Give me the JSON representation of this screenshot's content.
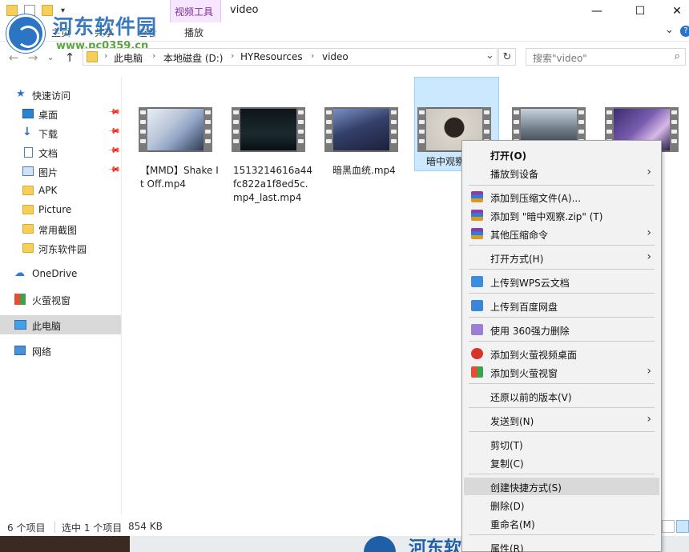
{
  "window": {
    "title": "video",
    "contextual_tab_group": "视频工具",
    "min_glyph": "—",
    "max_glyph": "☐",
    "close_glyph": "✕"
  },
  "ribbon": {
    "tabs": [
      "主页",
      "共享",
      "查看",
      "播放"
    ],
    "expand_glyph": "⌄",
    "help_glyph": "?"
  },
  "watermark": {
    "text": "河东软件园",
    "url": "www.pc0359.cn"
  },
  "address": {
    "back_glyph": "←",
    "forward_glyph": "→",
    "recent_glyph": "⌄",
    "up_glyph": "↑",
    "segments": [
      "此电脑",
      "本地磁盘 (D:)",
      "HYResources",
      "video"
    ],
    "sep_glyph": "›",
    "dropdown_glyph": "⌄",
    "refresh_glyph": "↻"
  },
  "search": {
    "placeholder": "搜索\"video\"",
    "icon_glyph": "⌕"
  },
  "sidebar": {
    "pin_glyph": "📌",
    "items": [
      {
        "label": "快速访问",
        "icon": "star-icon"
      },
      {
        "label": "桌面",
        "icon": "desktop-icon",
        "pinned": true
      },
      {
        "label": "下载",
        "icon": "download-icon",
        "pinned": true
      },
      {
        "label": "文档",
        "icon": "document-icon",
        "pinned": true
      },
      {
        "label": "图片",
        "icon": "picture-icon",
        "pinned": true
      },
      {
        "label": "APK",
        "icon": "folder-icon"
      },
      {
        "label": "Picture",
        "icon": "folder-icon"
      },
      {
        "label": "常用截图",
        "icon": "folder-icon"
      },
      {
        "label": "河东软件园",
        "icon": "folder-icon"
      },
      {
        "label": "OneDrive",
        "icon": "cloud-icon"
      },
      {
        "label": "火萤视窗",
        "icon": "windows-icon"
      },
      {
        "label": "此电脑",
        "icon": "computer-icon",
        "selected": true
      },
      {
        "label": "网络",
        "icon": "network-icon"
      }
    ]
  },
  "files": [
    {
      "name": "【MMD】Shake It Off.mp4"
    },
    {
      "name": "1513214616a44fc822a1f8ed5c.mp4_last.mp4"
    },
    {
      "name": "暗黑血统.mp4"
    },
    {
      "name": "暗中观察.mp4",
      "selected": true
    },
    {
      "name": ""
    },
    {
      "name": ""
    }
  ],
  "status": {
    "count": "6 个项目",
    "selection": "选中 1 个项目",
    "size": "854 KB"
  },
  "context_menu": {
    "submenu_glyph": "›",
    "items": [
      {
        "label": "打开(O)",
        "bold": true
      },
      {
        "label": "播放到设备",
        "submenu": true
      },
      {
        "label": "添加到压缩文件(A)...",
        "icon": "winrar-icon"
      },
      {
        "label": "添加到 \"暗中观察.zip\" (T)",
        "icon": "winrar-icon"
      },
      {
        "label": "其他压缩命令",
        "icon": "winrar-icon",
        "submenu": true
      },
      {
        "label": "打开方式(H)",
        "submenu": true
      },
      {
        "label": "上传到WPS云文档",
        "icon": "wps-cloud-icon"
      },
      {
        "label": "上传到百度网盘",
        "icon": "baidu-netdisk-icon"
      },
      {
        "label": "使用 360强力删除",
        "icon": "shred-icon"
      },
      {
        "label": "添加到火萤视频桌面",
        "icon": "huoying-icon"
      },
      {
        "label": "添加到火萤视窗",
        "icon": "huoying-windows-icon",
        "submenu": true
      },
      {
        "label": "还原以前的版本(V)"
      },
      {
        "label": "发送到(N)",
        "submenu": true
      },
      {
        "label": "剪切(T)"
      },
      {
        "label": "复制(C)"
      },
      {
        "label": "创建快捷方式(S)",
        "hover": true
      },
      {
        "label": "删除(D)"
      },
      {
        "label": "重命名(M)"
      },
      {
        "label": "属性(R)"
      }
    ]
  }
}
